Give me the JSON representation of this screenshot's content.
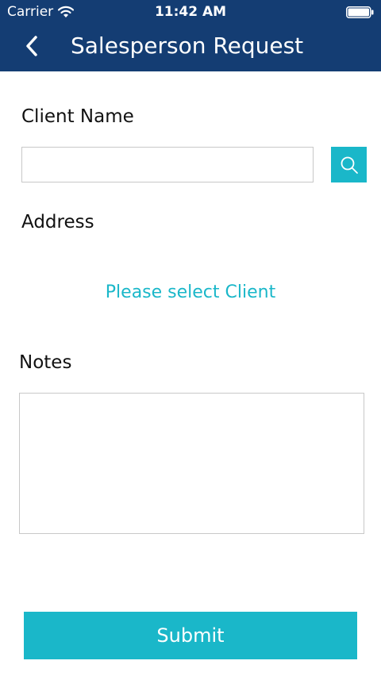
{
  "status_bar": {
    "carrier": "Carrier",
    "time": "11:42 AM",
    "wifi_icon": "wifi-icon",
    "battery_icon": "battery-icon"
  },
  "nav": {
    "back_icon": "chevron-left-icon",
    "title": "Salesperson Request"
  },
  "form": {
    "client_name_label": "Client Name",
    "client_name_value": "",
    "search_icon": "search-icon",
    "address_label": "Address",
    "address_placeholder": "Please select Client",
    "notes_label": "Notes",
    "notes_value": "",
    "submit_label": "Submit"
  },
  "colors": {
    "header": "#143d73",
    "accent": "#1ab7c9",
    "border": "#c8c8c8"
  }
}
